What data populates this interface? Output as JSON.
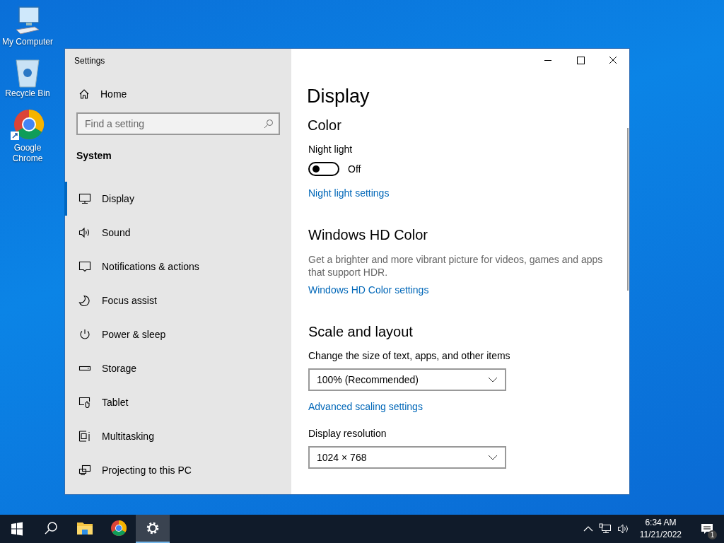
{
  "desktop_icons": [
    {
      "kind": "computer",
      "label": "My Computer"
    },
    {
      "kind": "bin",
      "label": "Recycle Bin"
    },
    {
      "kind": "chrome",
      "label": "Google Chrome"
    }
  ],
  "window": {
    "title": "Settings"
  },
  "sidebar": {
    "home": "Home",
    "search": {
      "placeholder": "Find a setting"
    },
    "section": "System",
    "items": [
      {
        "kind": "display",
        "label": "Display",
        "selected": true
      },
      {
        "kind": "sound",
        "label": "Sound",
        "selected": false
      },
      {
        "kind": "notifications",
        "label": "Notifications & actions",
        "selected": false
      },
      {
        "kind": "focus",
        "label": "Focus assist",
        "selected": false
      },
      {
        "kind": "power",
        "label": "Power & sleep",
        "selected": false
      },
      {
        "kind": "storage",
        "label": "Storage",
        "selected": false
      },
      {
        "kind": "tablet",
        "label": "Tablet",
        "selected": false
      },
      {
        "kind": "multitasking",
        "label": "Multitasking",
        "selected": false
      },
      {
        "kind": "projecting",
        "label": "Projecting to this PC",
        "selected": false
      }
    ]
  },
  "content": {
    "title": "Display",
    "color": {
      "heading": "Color",
      "night_light": {
        "label": "Night light",
        "on": false,
        "state_text": "Off"
      },
      "link": "Night light settings"
    },
    "hd_color": {
      "heading": "Windows HD Color",
      "description": "Get a brighter and more vibrant picture for videos, games and apps that support HDR.",
      "link": "Windows HD Color settings"
    },
    "scale": {
      "heading": "Scale and layout",
      "size_label": "Change the size of text, apps, and other items",
      "size_value": "100% (Recommended)",
      "advanced_link": "Advanced scaling settings",
      "resolution_label": "Display resolution",
      "resolution_value": "1024 × 768"
    }
  },
  "taskbar": {
    "pinned": [
      {
        "kind": "explorer",
        "selected": false
      },
      {
        "kind": "chrome",
        "selected": false
      },
      {
        "kind": "settings",
        "selected": true
      }
    ],
    "time": "6:34 AM",
    "date": "11/21/2022",
    "notification_count": "1"
  }
}
